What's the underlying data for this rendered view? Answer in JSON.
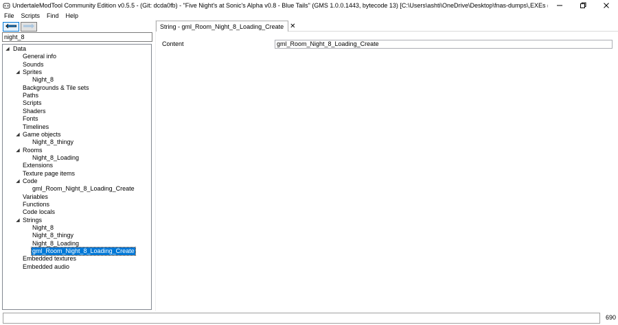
{
  "window": {
    "title": "UndertaleModTool Community Edition v0.5.5 - (Git: dcda0fb) - \"Five Night's at Sonic's Alpha v0.8 - Blue Tails\" (GMS 1.0.0.1443, bytecode 13) [C:\\Users\\ashti\\OneDrive\\Desktop\\fnas-dumps\\,EXEs (with data.wins)...",
    "icons": {
      "app": "gamepad-icon",
      "minimize": "minimize-icon",
      "maximize": "restore-icon",
      "close": "close-icon"
    }
  },
  "menu": [
    "File",
    "Scripts",
    "Find",
    "Help"
  ],
  "nav": {
    "back_icon": "arrow-left-icon",
    "forward_icon": "arrow-right-icon"
  },
  "search": {
    "value": "night_8"
  },
  "tree": [
    {
      "label": "Data",
      "level": 0,
      "expanded": true
    },
    {
      "label": "General info",
      "level": 1
    },
    {
      "label": "Sounds",
      "level": 1
    },
    {
      "label": "Sprites",
      "level": 1,
      "expanded": true
    },
    {
      "label": "Night_8",
      "level": 2
    },
    {
      "label": "Backgrounds & Tile sets",
      "level": 1
    },
    {
      "label": "Paths",
      "level": 1
    },
    {
      "label": "Scripts",
      "level": 1
    },
    {
      "label": "Shaders",
      "level": 1
    },
    {
      "label": "Fonts",
      "level": 1
    },
    {
      "label": "Timelines",
      "level": 1
    },
    {
      "label": "Game objects",
      "level": 1,
      "expanded": true
    },
    {
      "label": "Night_8_thingy",
      "level": 2
    },
    {
      "label": "Rooms",
      "level": 1,
      "expanded": true
    },
    {
      "label": "Night_8_Loading",
      "level": 2
    },
    {
      "label": "Extensions",
      "level": 1
    },
    {
      "label": "Texture page items",
      "level": 1
    },
    {
      "label": "Code",
      "level": 1,
      "expanded": true
    },
    {
      "label": "gml_Room_Night_8_Loading_Create",
      "level": 2
    },
    {
      "label": "Variables",
      "level": 1
    },
    {
      "label": "Functions",
      "level": 1
    },
    {
      "label": "Code locals",
      "level": 1
    },
    {
      "label": "Strings",
      "level": 1,
      "expanded": true
    },
    {
      "label": "Night_8",
      "level": 2
    },
    {
      "label": "Night_8_thingy",
      "level": 2
    },
    {
      "label": "Night_8_Loading",
      "level": 2
    },
    {
      "label": "gml_Room_Night_8_Loading_Create",
      "level": 2,
      "selected": true
    },
    {
      "label": "Embedded textures",
      "level": 1
    },
    {
      "label": "Embedded audio",
      "level": 1
    }
  ],
  "tab": {
    "label": "String - gml_Room_Night_8_Loading_Create",
    "close_glyph": "✕"
  },
  "editor": {
    "content_label": "Content",
    "content_value": "gml_Room_Night_8_Loading_Create"
  },
  "status": {
    "count": "690"
  },
  "colors": {
    "selection": "#0078d7",
    "nav_back": "#0078d7"
  }
}
